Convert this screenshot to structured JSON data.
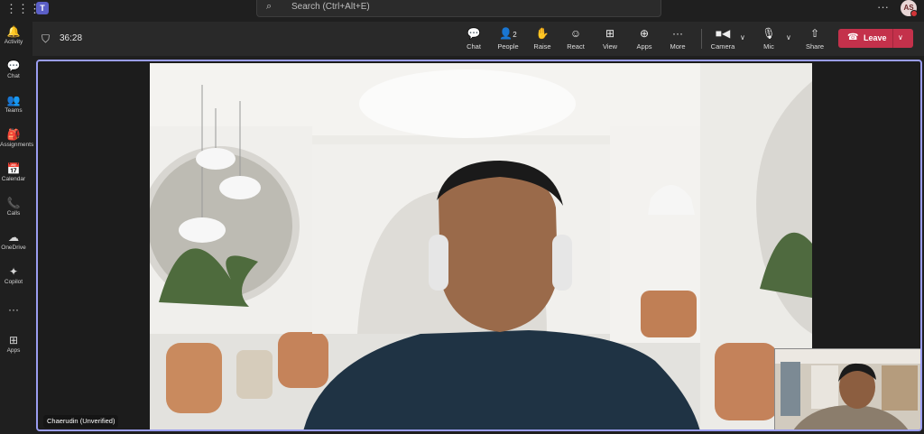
{
  "topbar": {
    "search_placeholder": "Search (Ctrl+Alt+E)",
    "more_label": "···",
    "avatar_initials": "AS"
  },
  "rail": [
    {
      "label": "Activity",
      "icon": "bell-icon",
      "glyph": "🔔"
    },
    {
      "label": "Chat",
      "icon": "chat-icon",
      "glyph": "💬"
    },
    {
      "label": "Teams",
      "icon": "teams-icon",
      "glyph": "👥"
    },
    {
      "label": "Assignments",
      "icon": "assignments-icon",
      "glyph": "🎒"
    },
    {
      "label": "Calendar",
      "icon": "calendar-icon",
      "glyph": "📅"
    },
    {
      "label": "Calls",
      "icon": "phone-icon",
      "glyph": "📞"
    },
    {
      "label": "OneDrive",
      "icon": "cloud-icon",
      "glyph": "☁"
    },
    {
      "label": "Copilot",
      "icon": "copilot-icon",
      "glyph": "✦"
    },
    {
      "label": "",
      "icon": "more-icon",
      "glyph": "···"
    },
    {
      "label": "Apps",
      "icon": "apps-icon",
      "glyph": "⊞"
    }
  ],
  "meeting": {
    "timer": "36:28",
    "people_count": "2",
    "buttons": {
      "chat": "Chat",
      "people": "People",
      "raise": "Raise",
      "react": "React",
      "view": "View",
      "apps": "Apps",
      "more": "More",
      "camera": "Camera",
      "mic": "Mic",
      "share": "Share",
      "leave": "Leave"
    },
    "participant_name": "Chaerudin (Unverified)"
  },
  "colors": {
    "accent": "#5b5fc7",
    "leave": "#c4314b",
    "stage_border": "#9a9df0"
  }
}
